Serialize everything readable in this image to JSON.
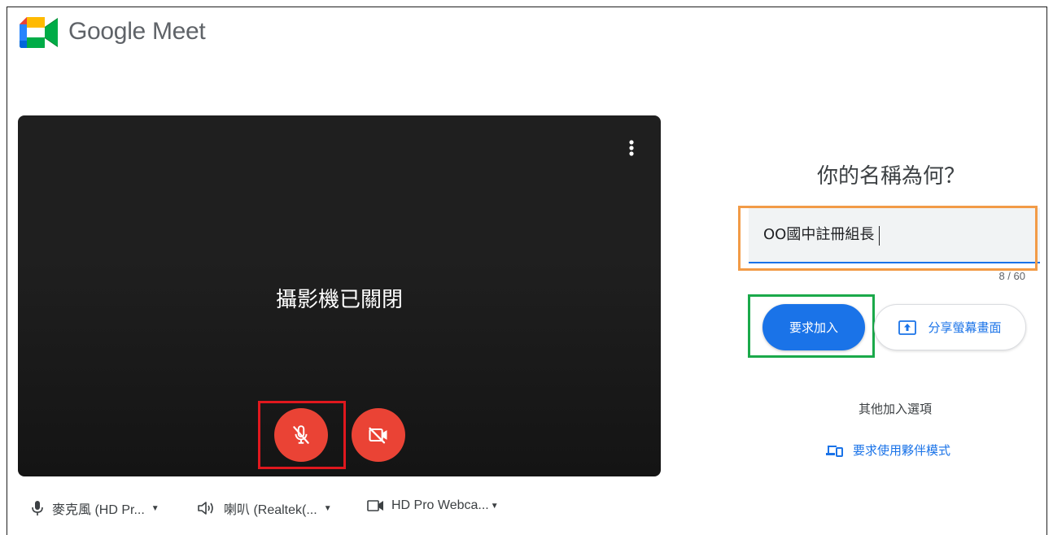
{
  "header": {
    "brand_name": "Google Meet",
    "logo_icon": "google-meet-logo"
  },
  "preview": {
    "camera_off_text": "攝影機已關閉",
    "more_options_icon": "more-vert-icon",
    "mic_button_icon": "mic-off-icon",
    "camera_button_icon": "videocam-off-icon",
    "button_color": "#ea4335"
  },
  "devices": {
    "microphone": {
      "label": "麥克風 (HD Pr...",
      "icon": "mic-icon"
    },
    "speaker": {
      "label": "喇叭 (Realtek(...",
      "icon": "volume-icon"
    },
    "camera": {
      "label": "HD Pro Webca...",
      "icon": "videocam-icon"
    }
  },
  "join_panel": {
    "title": "你的名稱為何？",
    "name_value": "OO國中註冊組長",
    "char_counter": "8 / 60",
    "join_button_label": "要求加入",
    "share_button_label": "分享螢幕畫面",
    "share_icon": "present-to-all-icon",
    "other_options_title": "其他加入選項",
    "companion_label": "要求使用夥伴模式",
    "companion_icon": "devices-icon",
    "accent_color": "#1a73e8"
  },
  "annotations": {
    "mic_highlight_color": "#e0181e",
    "name_highlight_color": "#f29b47",
    "join_highlight_color": "#1aa94a"
  }
}
